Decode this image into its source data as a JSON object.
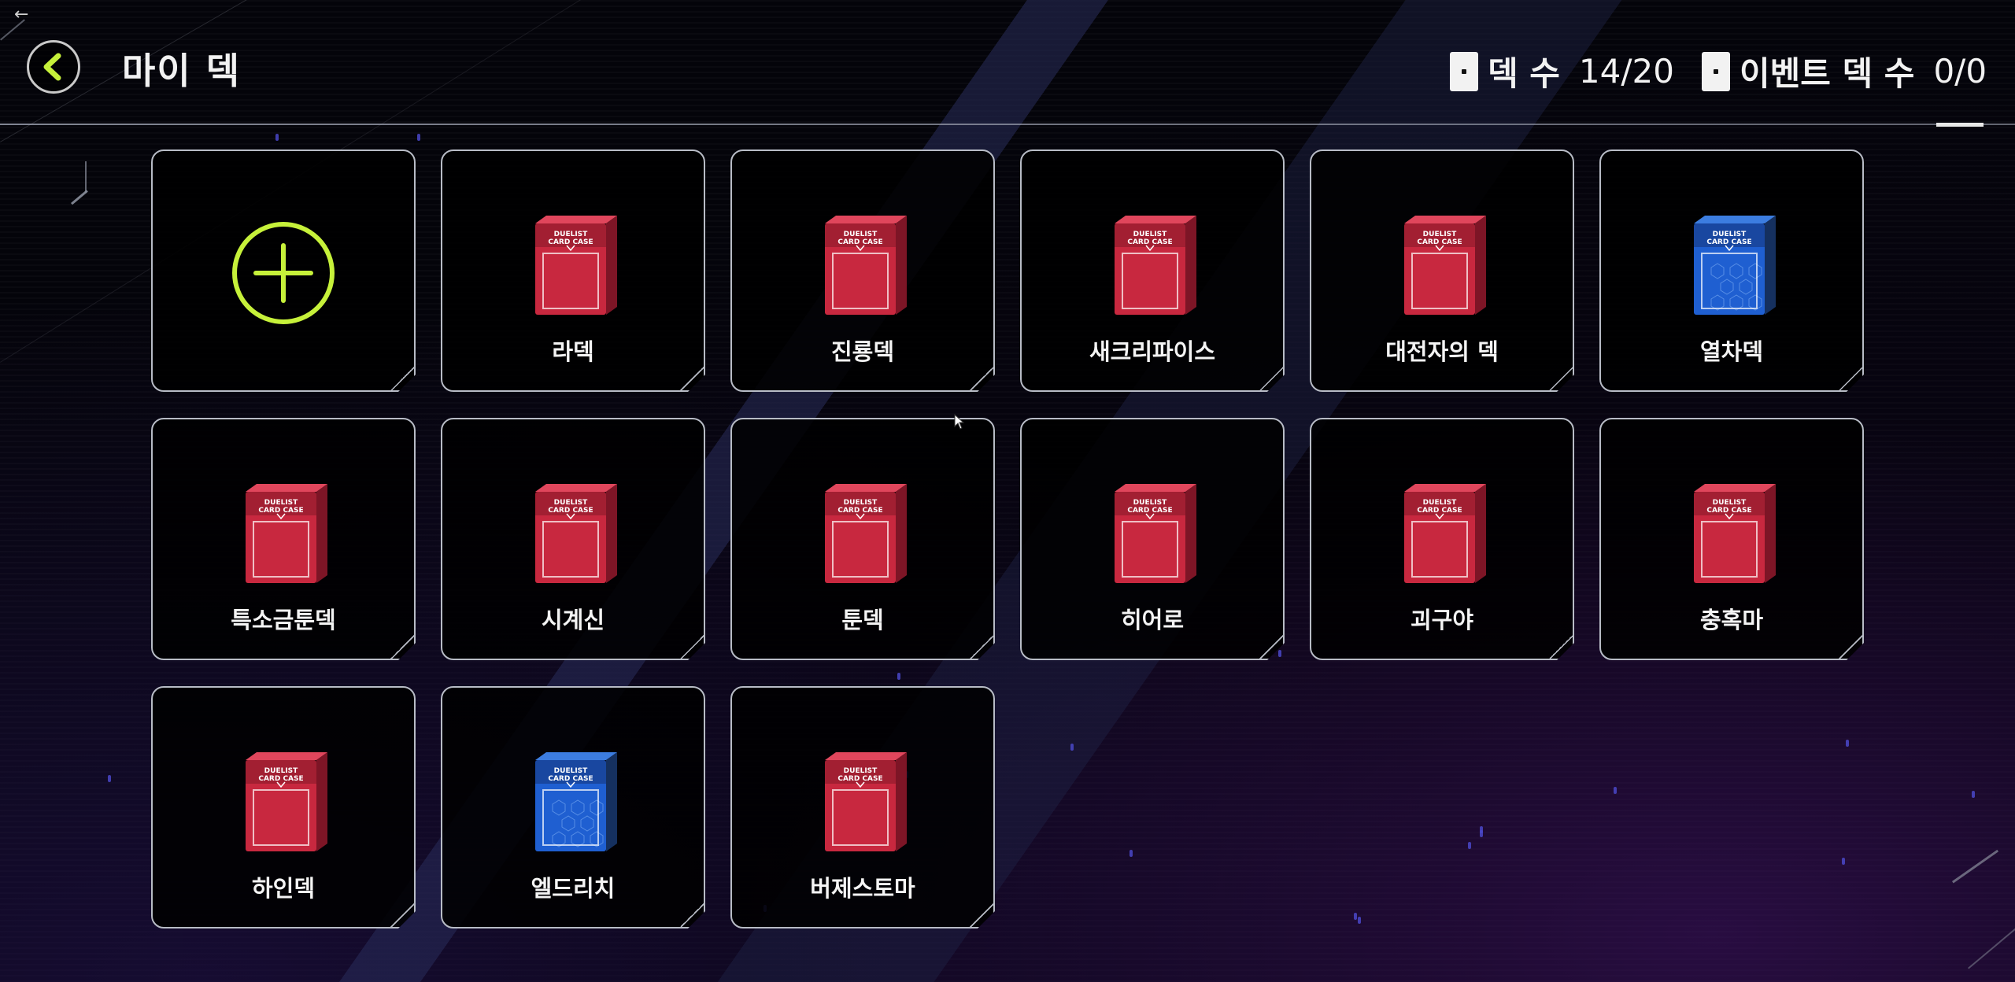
{
  "header": {
    "title": "마이 덱",
    "deck_count_label": "덱 수",
    "deck_count_value": "14/20",
    "event_deck_label": "이벤트 덱 수",
    "event_deck_value": "0/0"
  },
  "colors": {
    "accent": "#c6f13a",
    "deck_red": "#c8283f",
    "deck_blue": "#1f5fd1",
    "tile_border": "#b8bcc6"
  },
  "add_tile": {
    "icon": "plus-circle-icon"
  },
  "decks": [
    {
      "name": "라덱",
      "box": "red"
    },
    {
      "name": "진룡덱",
      "box": "red"
    },
    {
      "name": "새크리파이스",
      "box": "red"
    },
    {
      "name": "대전자의 덱",
      "box": "red"
    },
    {
      "name": "열차덱",
      "box": "blue"
    },
    {
      "name": "특소금툰덱",
      "box": "red"
    },
    {
      "name": "시계신",
      "box": "red"
    },
    {
      "name": "툰덱",
      "box": "red"
    },
    {
      "name": "히어로",
      "box": "red"
    },
    {
      "name": "괴구야",
      "box": "red"
    },
    {
      "name": "충혹마",
      "box": "red"
    },
    {
      "name": "하인덱",
      "box": "red"
    },
    {
      "name": "엘드리치",
      "box": "blue"
    },
    {
      "name": "버제스토마",
      "box": "red"
    }
  ]
}
